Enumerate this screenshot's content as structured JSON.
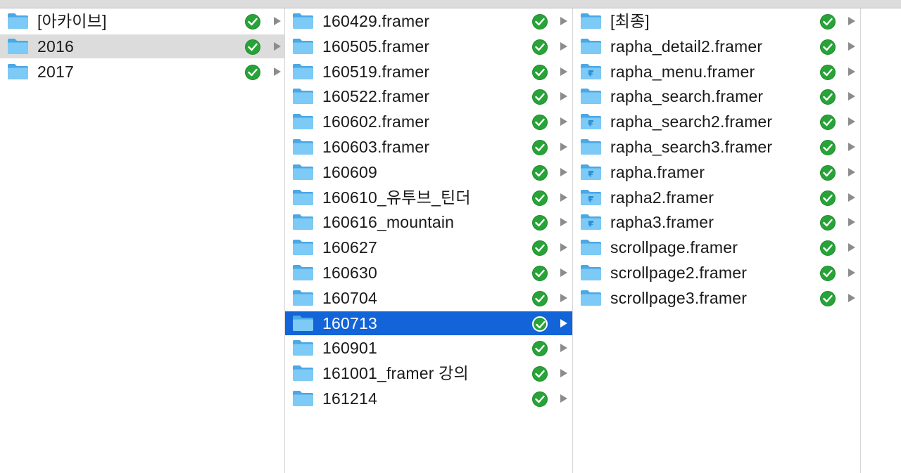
{
  "columns": [
    {
      "items": [
        {
          "label": "[아카이브]",
          "type": "folder",
          "selected": "none"
        },
        {
          "label": "2016",
          "type": "folder",
          "selected": "inactive"
        },
        {
          "label": "2017",
          "type": "folder",
          "selected": "none"
        }
      ]
    },
    {
      "items": [
        {
          "label": "160429.framer",
          "type": "folder",
          "selected": "none"
        },
        {
          "label": "160505.framer",
          "type": "folder",
          "selected": "none"
        },
        {
          "label": "160519.framer",
          "type": "folder",
          "selected": "none"
        },
        {
          "label": "160522.framer",
          "type": "folder",
          "selected": "none"
        },
        {
          "label": "160602.framer",
          "type": "folder",
          "selected": "none"
        },
        {
          "label": "160603.framer",
          "type": "folder",
          "selected": "none"
        },
        {
          "label": "160609",
          "type": "folder",
          "selected": "none"
        },
        {
          "label": "160610_유투브_틴더",
          "type": "folder",
          "selected": "none"
        },
        {
          "label": "160616_mountain",
          "type": "folder",
          "selected": "none"
        },
        {
          "label": "160627",
          "type": "folder",
          "selected": "none"
        },
        {
          "label": "160630",
          "type": "folder",
          "selected": "none"
        },
        {
          "label": "160704",
          "type": "folder",
          "selected": "none"
        },
        {
          "label": "160713",
          "type": "folder",
          "selected": "active"
        },
        {
          "label": "160901",
          "type": "folder",
          "selected": "none"
        },
        {
          "label": "161001_framer 강의",
          "type": "folder",
          "selected": "none"
        },
        {
          "label": "161214",
          "type": "folder",
          "selected": "none"
        }
      ]
    },
    {
      "items": [
        {
          "label": "[최종]",
          "type": "folder",
          "selected": "none"
        },
        {
          "label": "rapha_detail2.framer",
          "type": "folder",
          "selected": "none"
        },
        {
          "label": "rapha_menu.framer",
          "type": "framer-folder",
          "selected": "none"
        },
        {
          "label": "rapha_search.framer",
          "type": "folder",
          "selected": "none"
        },
        {
          "label": "rapha_search2.framer",
          "type": "framer-folder",
          "selected": "none"
        },
        {
          "label": "rapha_search3.framer",
          "type": "folder",
          "selected": "none"
        },
        {
          "label": "rapha.framer",
          "type": "framer-folder",
          "selected": "none"
        },
        {
          "label": "rapha2.framer",
          "type": "framer-folder",
          "selected": "none"
        },
        {
          "label": "rapha3.framer",
          "type": "framer-folder",
          "selected": "none"
        },
        {
          "label": "scrollpage.framer",
          "type": "folder",
          "selected": "none"
        },
        {
          "label": "scrollpage2.framer",
          "type": "folder",
          "selected": "none"
        },
        {
          "label": "scrollpage3.framer",
          "type": "folder",
          "selected": "none"
        }
      ]
    }
  ],
  "icons": {
    "folder": "folder-icon",
    "framer_folder": "framer-folder-icon",
    "status": "sync-check-icon",
    "disclosure": "disclosure-arrow-icon"
  },
  "colors": {
    "selection_active": "#1364d9",
    "selection_inactive": "#dcdcdc",
    "sync_green": "#27a337",
    "folder_blue": "#5cb8f0"
  }
}
